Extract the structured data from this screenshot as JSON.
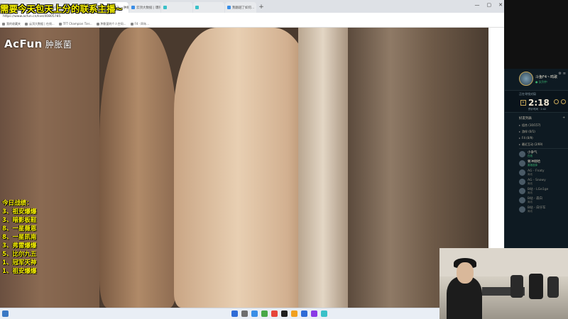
{
  "overlay": {
    "banner": "需要今天包天上分的联系主播~",
    "watermark_brand": "AcFun",
    "watermark_name": "肿胀菌",
    "stats_title": "今日战绩：",
    "stats": [
      "3、祖安爆爆",
      "3、暗影板鞋",
      "8、一星薇恩",
      "8、一星凯南",
      "3、弗雷爆爆",
      "5、比尔九五",
      "1、冠军天神",
      "1、祖安爆爆"
    ]
  },
  "browser": {
    "tabs": [
      {
        "label": "",
        "color": "#e6453a"
      },
      {
        "label": "【...】 AcFun...",
        "color": "#e6453a"
      },
      {
        "label": "肿胀菌的个人空间 · AcFun弹幕视频网",
        "color": "#e6453a"
      },
      {
        "label": "【求包天】 - 肿胀个人 • AcFun...",
        "color": "#e6453a",
        "active": true
      },
      {
        "label": "云顶大数据 | 爆肝...",
        "color": "#3a8ee6"
      },
      {
        "label": "",
        "color": "#3ac1c8"
      },
      {
        "label": "",
        "color": "#3ac1c8"
      },
      {
        "label": "我翻越了如何...",
        "color": "#3a8ee6"
      }
    ],
    "new_tab": "+",
    "window_controls": [
      "—",
      "▢",
      "✕"
    ],
    "url": "https://www.acfun.cn/live/40805785",
    "bookmarks": [
      "我的收藏夹",
      "云顶大数据 | 在线...",
      "TFT Champion Tier...",
      "肿胀菌的个人空间...",
      "F4 · 四年..."
    ]
  },
  "game": {
    "player_name": "斗鱼F4丶鸣歌",
    "player_status": "● 队列中",
    "queue_label": "正在寻找对局",
    "timer": "2:18",
    "queue_sub": "预计时间 · 2:42",
    "friends_header": "好友列表",
    "groups": [
      "组合 (10/157)",
      "游伴 (0/1)",
      "F4 (0/9)",
      "最近互动 (2/69)"
    ],
    "friends": [
      {
        "name": "小争气",
        "status": "在线",
        "online": true
      },
      {
        "name": "要冲刚哈",
        "status": "英雄选择",
        "online": true
      },
      {
        "name": "AG - Fnaty",
        "status": "离线",
        "online": false
      },
      {
        "name": "AG - Snowy",
        "status": "离线",
        "online": false
      },
      {
        "name": "B站 - LGe1ge",
        "status": "离线",
        "online": false
      },
      {
        "name": "B站 - 森白",
        "status": "离线",
        "online": false
      },
      {
        "name": "B站 - 白仔车",
        "status": "离线",
        "online": false
      }
    ]
  },
  "taskbar": {
    "icon_colors": [
      "#2f6bd6",
      "#6e6e6e",
      "#3a8ee6",
      "#48a848",
      "#e6453a",
      "#1f1f1f",
      "#f0a020",
      "#2f6bd6",
      "#8a3ae6",
      "#3ac1c8"
    ]
  }
}
